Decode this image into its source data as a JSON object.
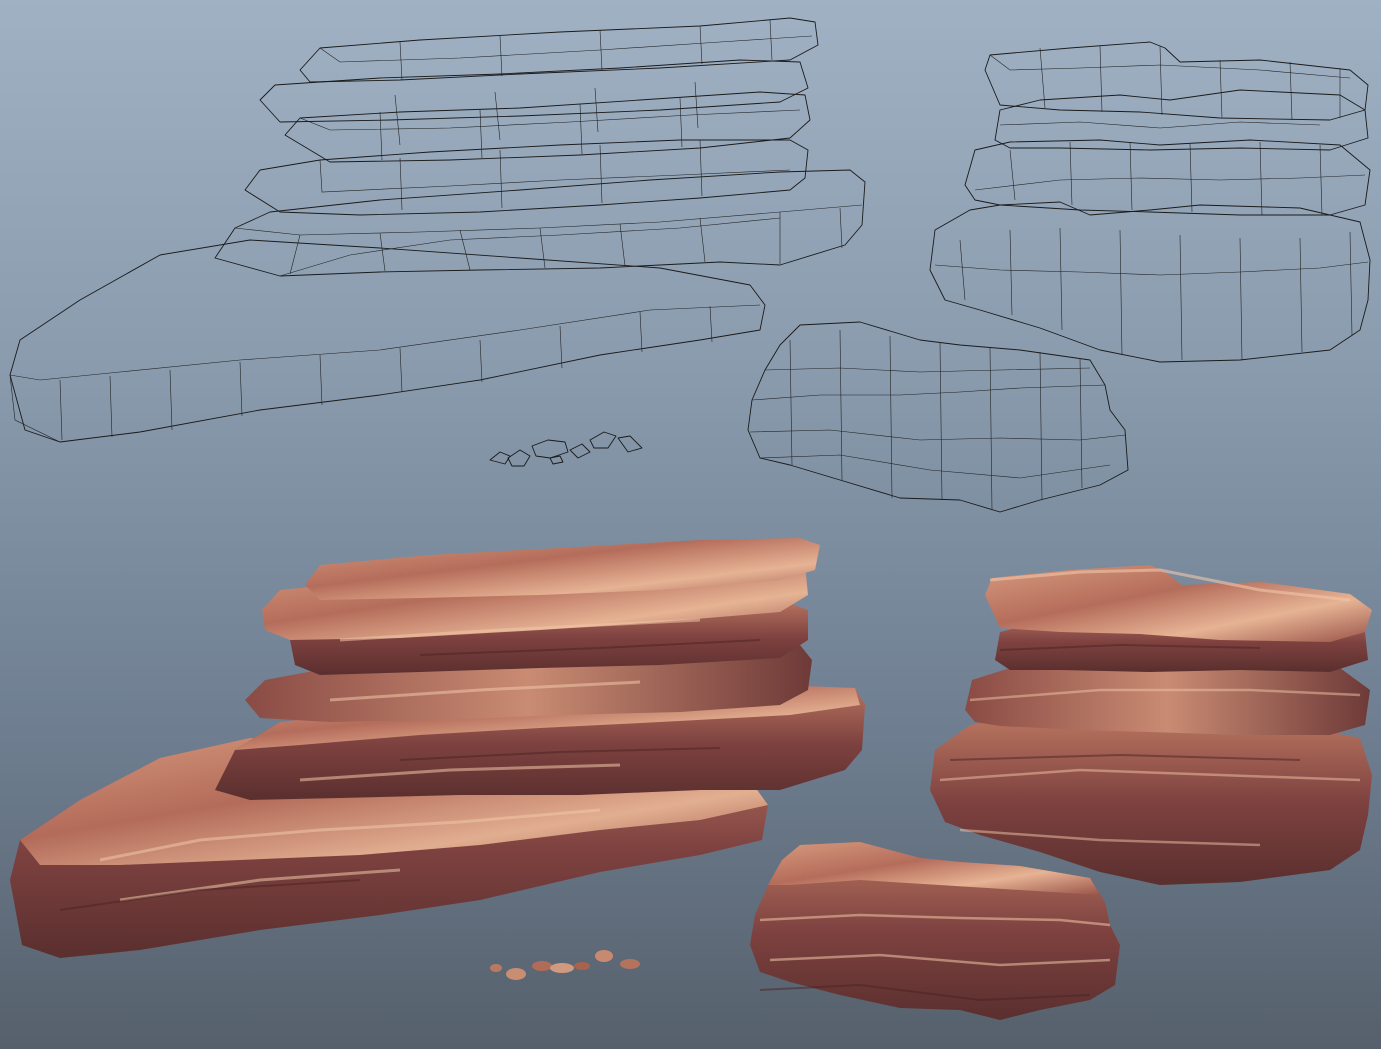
{
  "viewport": {
    "background_top": "#a0b1c4",
    "background_bottom": "#56606c"
  },
  "models": {
    "shaded_color": "#7a7672",
    "wireframe_color": "#1a1a1a",
    "textured_light": "#e0a88a",
    "textured_dark": "#5a2f2e",
    "items": [
      {
        "name": "large-mesa-wireframe",
        "view": "wireframe"
      },
      {
        "name": "tall-stack-wireframe",
        "view": "wireframe"
      },
      {
        "name": "small-ledge-wireframe",
        "view": "wireframe"
      },
      {
        "name": "pebbles-wireframe",
        "view": "wireframe"
      },
      {
        "name": "large-mesa-textured",
        "view": "textured"
      },
      {
        "name": "tall-stack-textured",
        "view": "textured"
      },
      {
        "name": "small-ledge-textured",
        "view": "textured"
      },
      {
        "name": "pebbles-textured",
        "view": "textured"
      }
    ]
  }
}
